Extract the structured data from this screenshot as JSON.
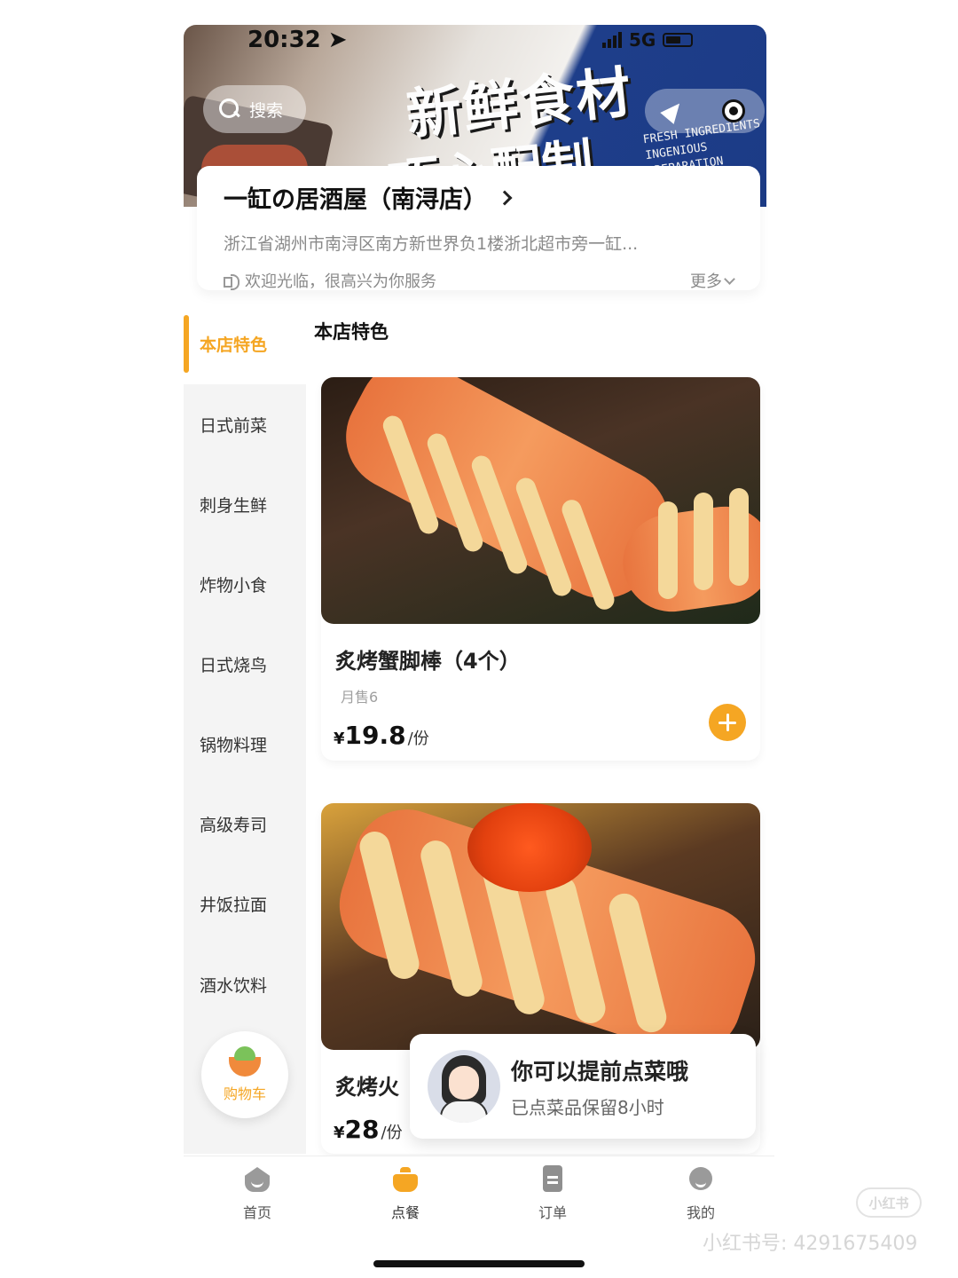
{
  "status_bar": {
    "time": "20:32",
    "network": "5G"
  },
  "banner": {
    "slogan_line1": "新鲜食材",
    "slogan_line2": "巧心配制",
    "english": [
      "FRESH INGREDIENTS",
      "INGENIOUS",
      "PREPARATION"
    ]
  },
  "search": {
    "placeholder": "搜索",
    "icon": "search-icon"
  },
  "store": {
    "name": "一缸の居酒屋（南浔店）",
    "address": "浙江省湖州市南浔区南方新世界负1楼浙北超市旁一缸...",
    "notice": "欢迎光临，很高兴为你服务",
    "more_label": "更多"
  },
  "sidebar": {
    "items": [
      {
        "label": "本店特色",
        "active": true
      },
      {
        "label": "日式前菜"
      },
      {
        "label": "刺身生鲜"
      },
      {
        "label": "炸物小食"
      },
      {
        "label": "日式烧鸟"
      },
      {
        "label": "锅物料理"
      },
      {
        "label": "高级寿司"
      },
      {
        "label": "井饭拉面"
      },
      {
        "label": "酒水饮料"
      }
    ],
    "cart_label": "购物车"
  },
  "section_title": "本店特色",
  "dishes": [
    {
      "name": "炙烤蟹脚棒（4个）",
      "sold": "月售6",
      "currency": "¥",
      "price": "19.8",
      "unit": "/份"
    },
    {
      "name": "炙烤火",
      "currency": "¥",
      "price": "28",
      "unit": "/份"
    }
  ],
  "tip": {
    "title": "你可以提前点菜哦",
    "subtitle": "已点菜品保留8小时"
  },
  "tabbar": [
    {
      "label": "首页",
      "icon": "home-icon"
    },
    {
      "label": "点餐",
      "icon": "pot-icon",
      "active": true
    },
    {
      "label": "订单",
      "icon": "order-icon"
    },
    {
      "label": "我的",
      "icon": "mine-icon"
    }
  ],
  "watermark": {
    "badge": "小红书",
    "text": "小红书号: 4291675409"
  },
  "colors": {
    "accent": "#f5a623",
    "banner_blue": "#1c3b86"
  }
}
